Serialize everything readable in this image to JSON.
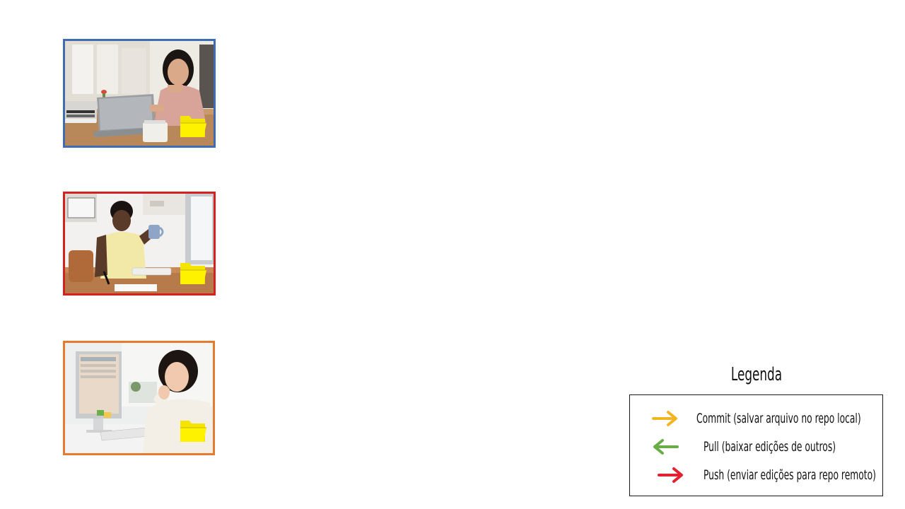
{
  "photos": [
    {
      "name": "woman-laptop-photo",
      "border_color": "#3f6db3",
      "folder_icon": "folder-icon"
    },
    {
      "name": "woman-desktop-coffee-photo",
      "border_color": "#d42020",
      "folder_icon": "folder-icon"
    },
    {
      "name": "woman-smiling-desktop-photo",
      "border_color": "#e47b2f",
      "folder_icon": "folder-icon"
    }
  ],
  "legend": {
    "title": "Legenda",
    "items": [
      {
        "label": "Commit (salvar arquivo no repo local)",
        "icon": "arrow-right-icon",
        "color": "#f2b523"
      },
      {
        "label": "Pull (baixar edições de outros)",
        "icon": "arrow-left-icon",
        "color": "#6aac45"
      },
      {
        "label": "Push (enviar edições para repo remoto)",
        "icon": "arrow-right-icon",
        "color": "#e3202d"
      }
    ]
  }
}
